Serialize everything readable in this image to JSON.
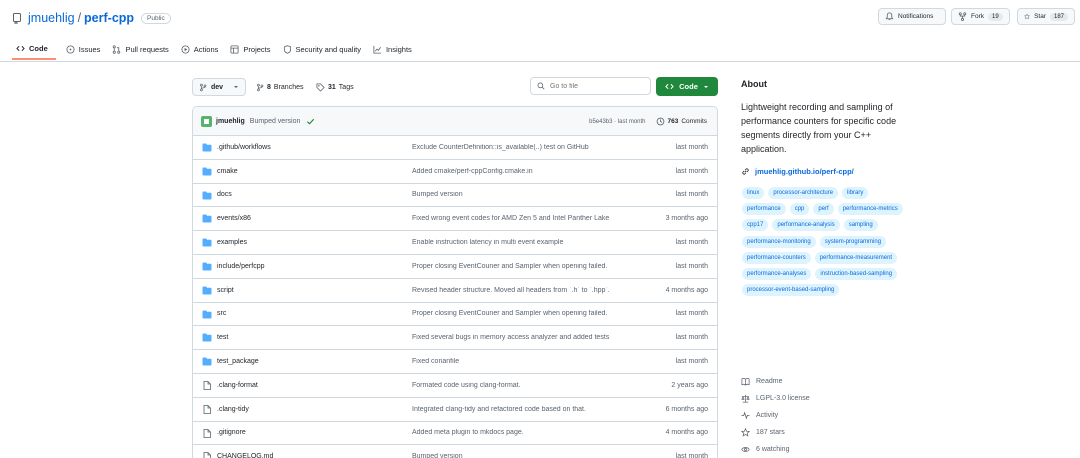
{
  "repo": {
    "owner": "jmuehlig",
    "separator": "/",
    "name": "perf-cpp",
    "visibility": "Public"
  },
  "header_actions": {
    "notifications_label": "Notifications",
    "fork_label": "Fork",
    "fork_count": "19",
    "star_label": "Star",
    "star_count": "187"
  },
  "tabs": [
    {
      "label": "Code",
      "icon": "code-icon",
      "active": true
    },
    {
      "label": "Issues",
      "icon": "issue-icon",
      "active": false
    },
    {
      "label": "Pull requests",
      "icon": "pull-request-icon",
      "active": false
    },
    {
      "label": "Actions",
      "icon": "play-icon",
      "active": false
    },
    {
      "label": "Projects",
      "icon": "table-icon",
      "active": false
    },
    {
      "label": "Security and quality",
      "icon": "shield-icon",
      "active": false
    },
    {
      "label": "Insights",
      "icon": "graph-icon",
      "active": false
    }
  ],
  "toolbar": {
    "branch": "dev",
    "branches_count": "8",
    "branches_label": "Branches",
    "tags_count": "31",
    "tags_label": "Tags",
    "search_placeholder": "Go to file",
    "code_label": "Code"
  },
  "latest_commit": {
    "author": "jmuehlig",
    "message": "Bumped version",
    "hash_time": "b5e43b3 · last month",
    "commits_count": "763",
    "commits_label": "Commits"
  },
  "files": [
    {
      "name": ".github/workflows",
      "type": "folder",
      "message": "Exclude CounterDefinition::is_available(..) test on GitHub",
      "date": "last month"
    },
    {
      "name": "cmake",
      "type": "folder",
      "message": "Added cmake/perf-cppConfig.cmake.in",
      "date": "last month"
    },
    {
      "name": "docs",
      "type": "folder",
      "message": "Bumped version",
      "date": "last month"
    },
    {
      "name": "events/x86",
      "type": "folder",
      "message": "Fixed wrong event codes for AMD Zen 5 and Intel Panther Lake",
      "date": "3 months ago"
    },
    {
      "name": "examples",
      "type": "folder",
      "message": "Enable instruction latency in multi event example",
      "date": "last month"
    },
    {
      "name": "include/perfcpp",
      "type": "folder",
      "message": "Proper closing EventCouner and Sampler when opening failed.",
      "date": "last month"
    },
    {
      "name": "script",
      "type": "folder",
      "message": "Revised header structure. Moved all headers from `.h` to `.hpp`.",
      "date": "4 months ago"
    },
    {
      "name": "src",
      "type": "folder",
      "message": "Proper closing EventCouner and Sampler when opening failed.",
      "date": "last month"
    },
    {
      "name": "test",
      "type": "folder",
      "message": "Fixed several bugs in memory access analyzer and added tests",
      "date": "last month"
    },
    {
      "name": "test_package",
      "type": "folder",
      "message": "Fixed conanfile",
      "date": "last month"
    },
    {
      "name": ".clang-format",
      "type": "file",
      "message": "Formated code using clang-format.",
      "date": "2 years ago"
    },
    {
      "name": ".clang-tidy",
      "type": "file",
      "message": "Integrated clang-tidy and refactored code based on that.",
      "date": "6 months ago"
    },
    {
      "name": ".gitignore",
      "type": "file",
      "message": "Added meta plugin to mkdocs page.",
      "date": "4 months ago"
    },
    {
      "name": "CHANGELOG.md",
      "type": "file",
      "message": "Bumped version",
      "date": "last month"
    }
  ],
  "about": {
    "title": "About",
    "description": "Lightweight recording and sampling of performance counters for specific code segments directly from your C++ application.",
    "homepage": "jmuehlig.github.io/perf-cpp/",
    "topics": [
      "linux",
      "processor-architecture",
      "library",
      "performance",
      "cpp",
      "perf",
      "performance-metrics",
      "cpp17",
      "performance-analysis",
      "sampling",
      "performance-monitoring",
      "system-programming",
      "performance-counters",
      "performance-measurement",
      "performance-analyses",
      "instruction-based-sampling",
      "processor-event-based-sampling"
    ],
    "meta": [
      {
        "label": "Readme",
        "icon": "book-icon"
      },
      {
        "label": "LGPL-3.0 license",
        "icon": "law-icon"
      },
      {
        "label": "Activity",
        "icon": "pulse-icon"
      },
      {
        "label": "187 stars",
        "icon": "star-icon"
      },
      {
        "label": "6 watching",
        "icon": "eye-icon"
      }
    ]
  },
  "colors": {
    "accent": "#0969da",
    "code_button": "#1f883d",
    "folder": "#54aeff",
    "active_tab_underline": "#fd8c73",
    "topic_bg": "#ddf4ff"
  }
}
